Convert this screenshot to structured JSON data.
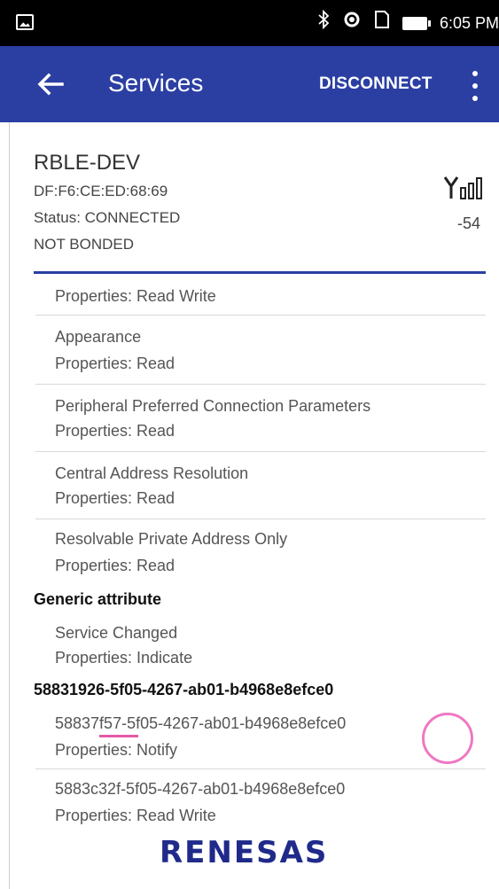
{
  "status_bar": {
    "time": "6:05 PM"
  },
  "app_bar": {
    "title": "Services",
    "disconnect_label": "DISCONNECT",
    "color": "#2b3fa3"
  },
  "device": {
    "name": "RBLE-DEV",
    "mac": "DF:F6:CE:ED:68:69",
    "status": "Status:  CONNECTED",
    "bond": "NOT BONDED",
    "rssi": "-54"
  },
  "list": {
    "item0_props": "Properties: Read Write",
    "item1_name": "Appearance",
    "item1_props": "Properties: Read",
    "item2_name": "Peripheral Preferred Connection Parameters",
    "item2_props": "Properties: Read",
    "item3_name": "Central Address Resolution",
    "item3_props": "Properties: Read",
    "item4_name": "Resolvable Private Address Only",
    "item4_props": "Properties: Read",
    "service1": "Generic attribute",
    "item5_name": "Service Changed",
    "item5_props": "Properties: Indicate",
    "service2": "58831926-5f05-4267-ab01-b4968e8efce0",
    "item6_name": "58837f57-5f05-4267-ab01-b4968e8efce0",
    "item6_props": "Properties: Notify",
    "item7_name": "5883c32f-5f05-4267-ab01-b4968e8efce0",
    "item7_props": "Properties: Read Write"
  },
  "logo_text": "RENESAS",
  "icons": {
    "back": "arrow-left",
    "overflow": "more-vert",
    "signal": "antenna-signal",
    "bluetooth": "bluetooth",
    "battery": "battery"
  }
}
